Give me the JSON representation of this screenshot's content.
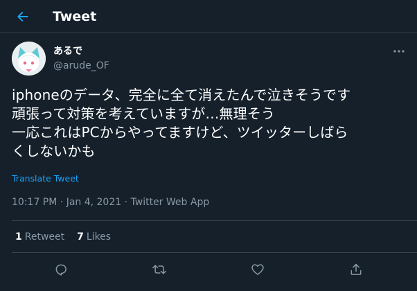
{
  "header": {
    "title": "Tweet"
  },
  "author": {
    "name": "あるで",
    "handle": "@arude_OF"
  },
  "tweet": {
    "text": "iphoneのデータ、完全に全て消えたんで泣きそうです\n頑張って対策を考えていますが…無理そう\n一応これはPCからやってますけど、ツイッターしばら\nくしないかも",
    "translate_label": "Translate Tweet",
    "time": "10:17 PM",
    "date": "Jan 4, 2021",
    "source": "Twitter Web App"
  },
  "stats": {
    "retweets_count": "1",
    "retweets_label": "Retweet",
    "likes_count": "7",
    "likes_label": "Likes"
  },
  "icons": {
    "back": "arrow-left-icon",
    "more": "more-dots-icon",
    "reply": "reply-icon",
    "retweet": "retweet-icon",
    "like": "heart-icon",
    "share": "share-icon"
  },
  "colors": {
    "background": "#15202b",
    "accent": "#1da1f2",
    "secondary_text": "#8899a6",
    "border": "#38444d"
  }
}
